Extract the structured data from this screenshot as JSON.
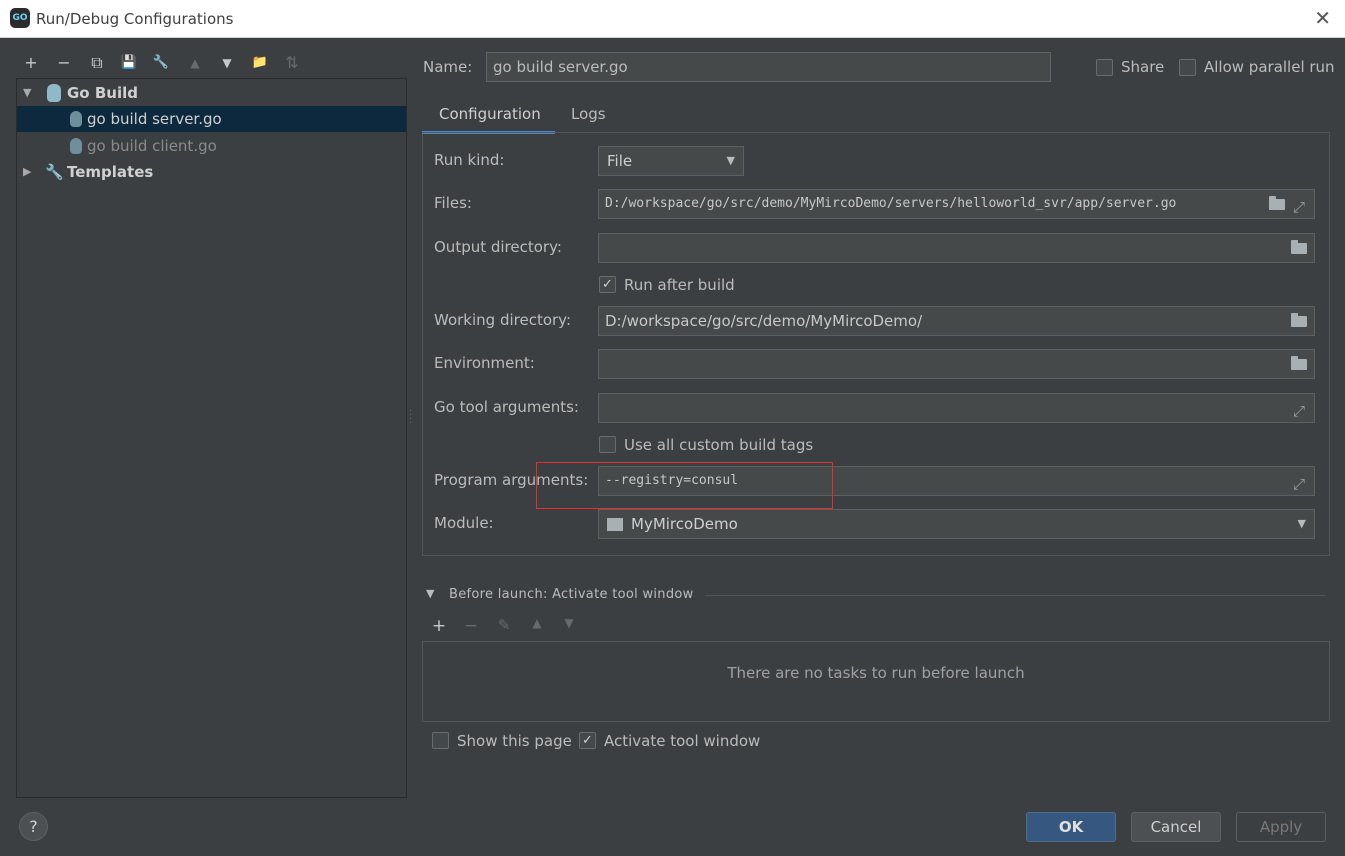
{
  "window": {
    "title": "Run/Debug Configurations",
    "app_icon_text": "GO",
    "close_glyph": "✕"
  },
  "toolbar": [
    "+",
    "−",
    "⧉",
    "💾",
    "🔧",
    "▲",
    "▼",
    "📁",
    "⇅"
  ],
  "tree": {
    "group": {
      "label": "Go Build",
      "expanded": true
    },
    "items": [
      {
        "label": "go build server.go",
        "selected": true
      },
      {
        "label": "go build client.go",
        "selected": false
      }
    ],
    "templates": {
      "label": "Templates"
    }
  },
  "name_label": "Name:",
  "name_value": "go build server.go",
  "share": {
    "label": "Share",
    "checked": false
  },
  "parallel": {
    "label": "Allow parallel run",
    "checked": false
  },
  "tabs": [
    {
      "label": "Configuration",
      "active": true
    },
    {
      "label": "Logs",
      "active": false
    }
  ],
  "config": {
    "run_kind": {
      "label": "Run kind:",
      "value": "File"
    },
    "files": {
      "label": "Files:",
      "value": "D:/workspace/go/src/demo/MyMircoDemo/servers/helloworld_svr/app/server.go"
    },
    "output_dir": {
      "label": "Output directory:",
      "value": ""
    },
    "run_after_build": {
      "label": "Run after build",
      "checked": true
    },
    "working_dir": {
      "label": "Working directory:",
      "value": "D:/workspace/go/src/demo/MyMircoDemo/"
    },
    "environment": {
      "label": "Environment:",
      "value": ""
    },
    "go_tool_args": {
      "label": "Go tool arguments:",
      "value": ""
    },
    "custom_build_tags": {
      "label": "Use all custom build tags",
      "checked": false
    },
    "program_args": {
      "label": "Program arguments:",
      "value": "--registry=consul"
    },
    "module": {
      "label": "Module:",
      "value": "MyMircoDemo"
    }
  },
  "before_launch": {
    "title": "Before launch: Activate tool window",
    "toolbar": [
      "+",
      "−",
      "✎",
      "▲",
      "▼"
    ],
    "empty_text": "There are no tasks to run before launch"
  },
  "show_page": {
    "label": "Show this page",
    "checked": false
  },
  "activate_tool": {
    "label": "Activate tool window",
    "checked": true
  },
  "buttons": {
    "help": "?",
    "ok": "OK",
    "cancel": "Cancel",
    "apply": "Apply"
  },
  "colors": {
    "accent": "#4a88c7",
    "selection": "#0d293e",
    "primary_button": "#365880",
    "highlight": "#e23030"
  }
}
